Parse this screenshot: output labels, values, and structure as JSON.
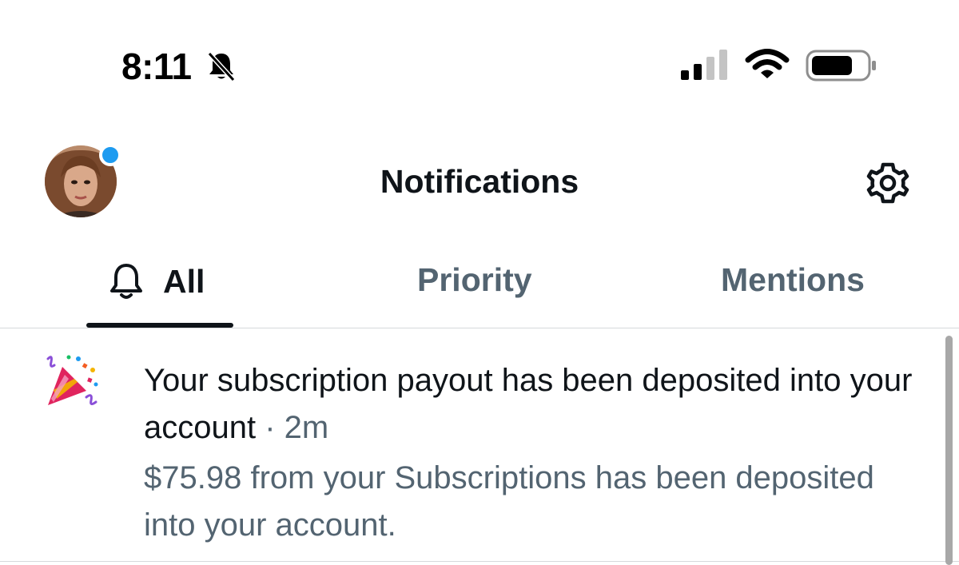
{
  "status_bar": {
    "time": "8:11",
    "icons": [
      "bell-slash-icon",
      "cellular-signal-icon",
      "wifi-icon",
      "battery-icon"
    ]
  },
  "header": {
    "title": "Notifications",
    "avatar": "profile-avatar",
    "settings_icon": "gear-icon",
    "avatar_indicator_color": "#1d9bf0"
  },
  "tabs": [
    {
      "label": "All",
      "icon": "bell-icon",
      "selected": true
    },
    {
      "label": "Priority",
      "selected": false
    },
    {
      "label": "Mentions",
      "selected": false
    }
  ],
  "notifications": [
    {
      "icon": "party-popper-icon",
      "title": "Your subscription payout has been deposited into your account",
      "separator": " · ",
      "time": "2m",
      "body": "$75.98 from your Subscriptions has been deposited into your account."
    }
  ],
  "colors": {
    "text_primary": "#0f1419",
    "text_secondary": "#536471",
    "accent": "#1d9bf0"
  }
}
